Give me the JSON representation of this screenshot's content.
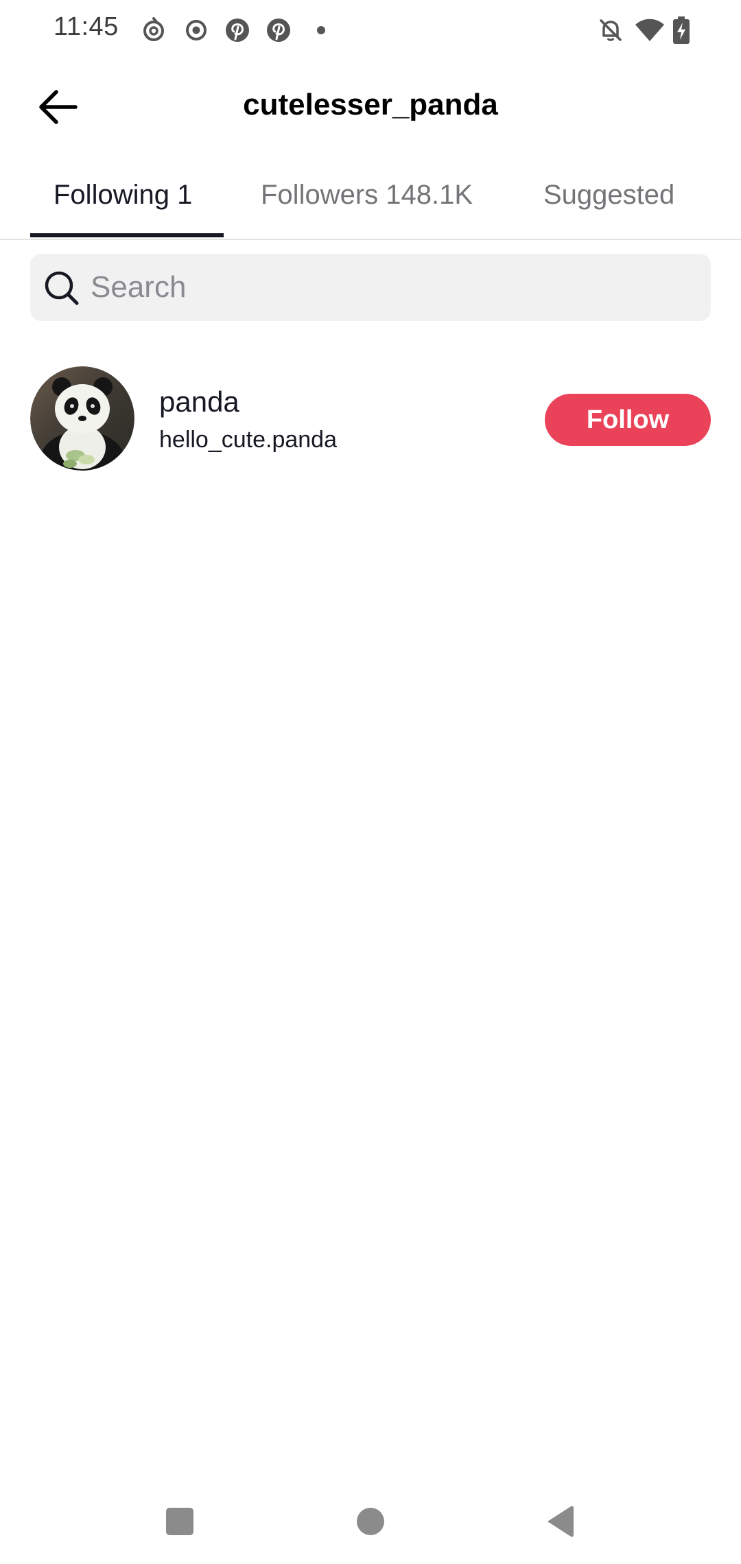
{
  "status_bar": {
    "time": "11:45",
    "icons": [
      "netease-music-icon",
      "record-icon",
      "pinterest-icon",
      "pinterest-icon",
      "dot-icon",
      "notifications-off-icon",
      "wifi-icon",
      "battery-charging-icon"
    ]
  },
  "header": {
    "title": "cutelesser_panda",
    "back_icon": "arrow-left-icon"
  },
  "tabs": [
    {
      "label": "Following 1",
      "active": true
    },
    {
      "label": "Followers 148.1K",
      "active": false
    },
    {
      "label": "Suggested",
      "active": false
    }
  ],
  "search": {
    "placeholder": "Search",
    "value": ""
  },
  "users": [
    {
      "name": "panda",
      "handle": "hello_cute.panda",
      "button_label": "Follow"
    }
  ],
  "colors": {
    "follow_button": "#ea4359",
    "active_tab": "#161823",
    "inactive_tab": "#747478",
    "search_bg": "#f1f1f2"
  },
  "nav_bar": {
    "icons": [
      "recents-square-icon",
      "home-circle-icon",
      "back-triangle-icon"
    ]
  }
}
